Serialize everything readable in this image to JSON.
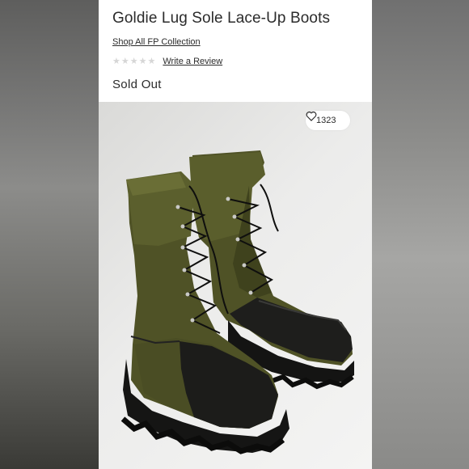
{
  "product": {
    "title": "Goldie Lug Sole Lace-Up Boots",
    "collection_link": "Shop All FP Collection",
    "rating_stars": 0,
    "review_link": "Write a Review",
    "availability": "Sold Out"
  },
  "image": {
    "like_count": "1323",
    "heart_icon": "heart-outline-icon",
    "subject": "olive-green-lace-up-boots-with-black-lug-soles"
  },
  "colors": {
    "text": "#2b2b2b",
    "star_empty": "#d6d6d6",
    "boot_olive": "#4f5226",
    "sole_black": "#1b1b1b"
  }
}
